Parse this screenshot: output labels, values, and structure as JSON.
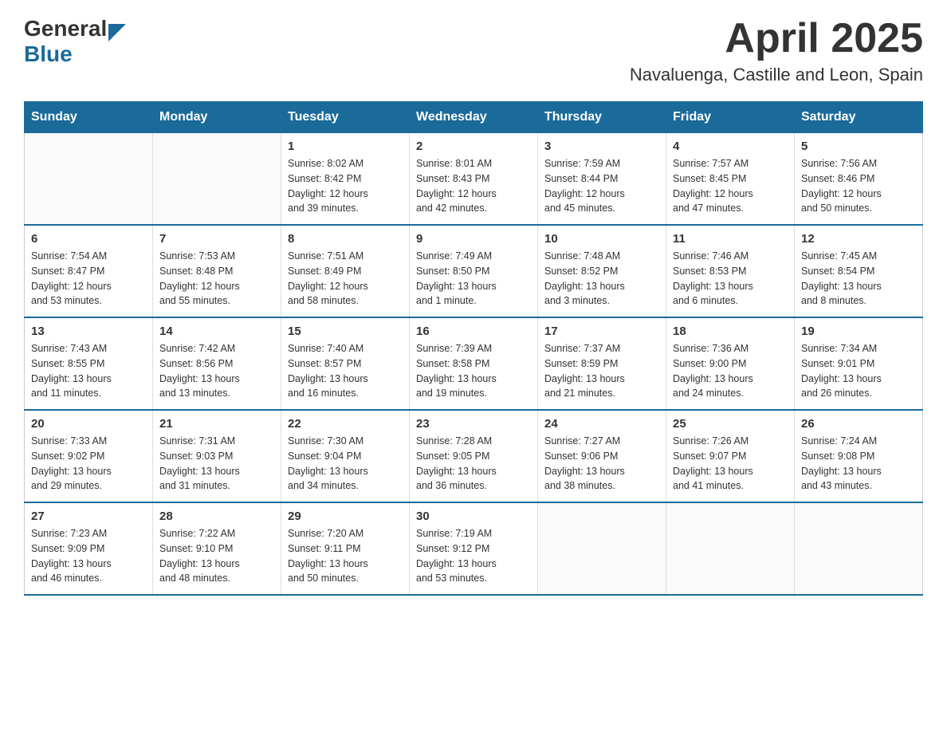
{
  "header": {
    "logo_general": "General",
    "logo_blue": "Blue",
    "title": "April 2025",
    "subtitle": "Navaluenga, Castille and Leon, Spain"
  },
  "calendar": {
    "days_of_week": [
      "Sunday",
      "Monday",
      "Tuesday",
      "Wednesday",
      "Thursday",
      "Friday",
      "Saturday"
    ],
    "weeks": [
      [
        {
          "day": "",
          "info": ""
        },
        {
          "day": "",
          "info": ""
        },
        {
          "day": "1",
          "info": "Sunrise: 8:02 AM\nSunset: 8:42 PM\nDaylight: 12 hours\nand 39 minutes."
        },
        {
          "day": "2",
          "info": "Sunrise: 8:01 AM\nSunset: 8:43 PM\nDaylight: 12 hours\nand 42 minutes."
        },
        {
          "day": "3",
          "info": "Sunrise: 7:59 AM\nSunset: 8:44 PM\nDaylight: 12 hours\nand 45 minutes."
        },
        {
          "day": "4",
          "info": "Sunrise: 7:57 AM\nSunset: 8:45 PM\nDaylight: 12 hours\nand 47 minutes."
        },
        {
          "day": "5",
          "info": "Sunrise: 7:56 AM\nSunset: 8:46 PM\nDaylight: 12 hours\nand 50 minutes."
        }
      ],
      [
        {
          "day": "6",
          "info": "Sunrise: 7:54 AM\nSunset: 8:47 PM\nDaylight: 12 hours\nand 53 minutes."
        },
        {
          "day": "7",
          "info": "Sunrise: 7:53 AM\nSunset: 8:48 PM\nDaylight: 12 hours\nand 55 minutes."
        },
        {
          "day": "8",
          "info": "Sunrise: 7:51 AM\nSunset: 8:49 PM\nDaylight: 12 hours\nand 58 minutes."
        },
        {
          "day": "9",
          "info": "Sunrise: 7:49 AM\nSunset: 8:50 PM\nDaylight: 13 hours\nand 1 minute."
        },
        {
          "day": "10",
          "info": "Sunrise: 7:48 AM\nSunset: 8:52 PM\nDaylight: 13 hours\nand 3 minutes."
        },
        {
          "day": "11",
          "info": "Sunrise: 7:46 AM\nSunset: 8:53 PM\nDaylight: 13 hours\nand 6 minutes."
        },
        {
          "day": "12",
          "info": "Sunrise: 7:45 AM\nSunset: 8:54 PM\nDaylight: 13 hours\nand 8 minutes."
        }
      ],
      [
        {
          "day": "13",
          "info": "Sunrise: 7:43 AM\nSunset: 8:55 PM\nDaylight: 13 hours\nand 11 minutes."
        },
        {
          "day": "14",
          "info": "Sunrise: 7:42 AM\nSunset: 8:56 PM\nDaylight: 13 hours\nand 13 minutes."
        },
        {
          "day": "15",
          "info": "Sunrise: 7:40 AM\nSunset: 8:57 PM\nDaylight: 13 hours\nand 16 minutes."
        },
        {
          "day": "16",
          "info": "Sunrise: 7:39 AM\nSunset: 8:58 PM\nDaylight: 13 hours\nand 19 minutes."
        },
        {
          "day": "17",
          "info": "Sunrise: 7:37 AM\nSunset: 8:59 PM\nDaylight: 13 hours\nand 21 minutes."
        },
        {
          "day": "18",
          "info": "Sunrise: 7:36 AM\nSunset: 9:00 PM\nDaylight: 13 hours\nand 24 minutes."
        },
        {
          "day": "19",
          "info": "Sunrise: 7:34 AM\nSunset: 9:01 PM\nDaylight: 13 hours\nand 26 minutes."
        }
      ],
      [
        {
          "day": "20",
          "info": "Sunrise: 7:33 AM\nSunset: 9:02 PM\nDaylight: 13 hours\nand 29 minutes."
        },
        {
          "day": "21",
          "info": "Sunrise: 7:31 AM\nSunset: 9:03 PM\nDaylight: 13 hours\nand 31 minutes."
        },
        {
          "day": "22",
          "info": "Sunrise: 7:30 AM\nSunset: 9:04 PM\nDaylight: 13 hours\nand 34 minutes."
        },
        {
          "day": "23",
          "info": "Sunrise: 7:28 AM\nSunset: 9:05 PM\nDaylight: 13 hours\nand 36 minutes."
        },
        {
          "day": "24",
          "info": "Sunrise: 7:27 AM\nSunset: 9:06 PM\nDaylight: 13 hours\nand 38 minutes."
        },
        {
          "day": "25",
          "info": "Sunrise: 7:26 AM\nSunset: 9:07 PM\nDaylight: 13 hours\nand 41 minutes."
        },
        {
          "day": "26",
          "info": "Sunrise: 7:24 AM\nSunset: 9:08 PM\nDaylight: 13 hours\nand 43 minutes."
        }
      ],
      [
        {
          "day": "27",
          "info": "Sunrise: 7:23 AM\nSunset: 9:09 PM\nDaylight: 13 hours\nand 46 minutes."
        },
        {
          "day": "28",
          "info": "Sunrise: 7:22 AM\nSunset: 9:10 PM\nDaylight: 13 hours\nand 48 minutes."
        },
        {
          "day": "29",
          "info": "Sunrise: 7:20 AM\nSunset: 9:11 PM\nDaylight: 13 hours\nand 50 minutes."
        },
        {
          "day": "30",
          "info": "Sunrise: 7:19 AM\nSunset: 9:12 PM\nDaylight: 13 hours\nand 53 minutes."
        },
        {
          "day": "",
          "info": ""
        },
        {
          "day": "",
          "info": ""
        },
        {
          "day": "",
          "info": ""
        }
      ]
    ]
  }
}
